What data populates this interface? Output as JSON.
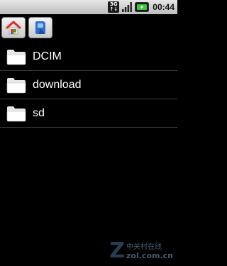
{
  "status_bar": {
    "network_badge": "3G",
    "network_badge_sub": "↑↓",
    "signal_icon": "signal-bars-icon",
    "battery_icon": "battery-charging-icon",
    "time": "00:44"
  },
  "toolbar": {
    "buttons": [
      {
        "icon": "home-icon"
      },
      {
        "icon": "bookmark-icon"
      }
    ]
  },
  "files": [
    {
      "name": "DCIM",
      "icon": "folder-icon"
    },
    {
      "name": "download",
      "icon": "folder-icon"
    },
    {
      "name": "sd",
      "icon": "folder-icon"
    }
  ],
  "watermark": {
    "letter": "Z",
    "chinese": "中关村在线",
    "domain": "zol.com.cn"
  }
}
